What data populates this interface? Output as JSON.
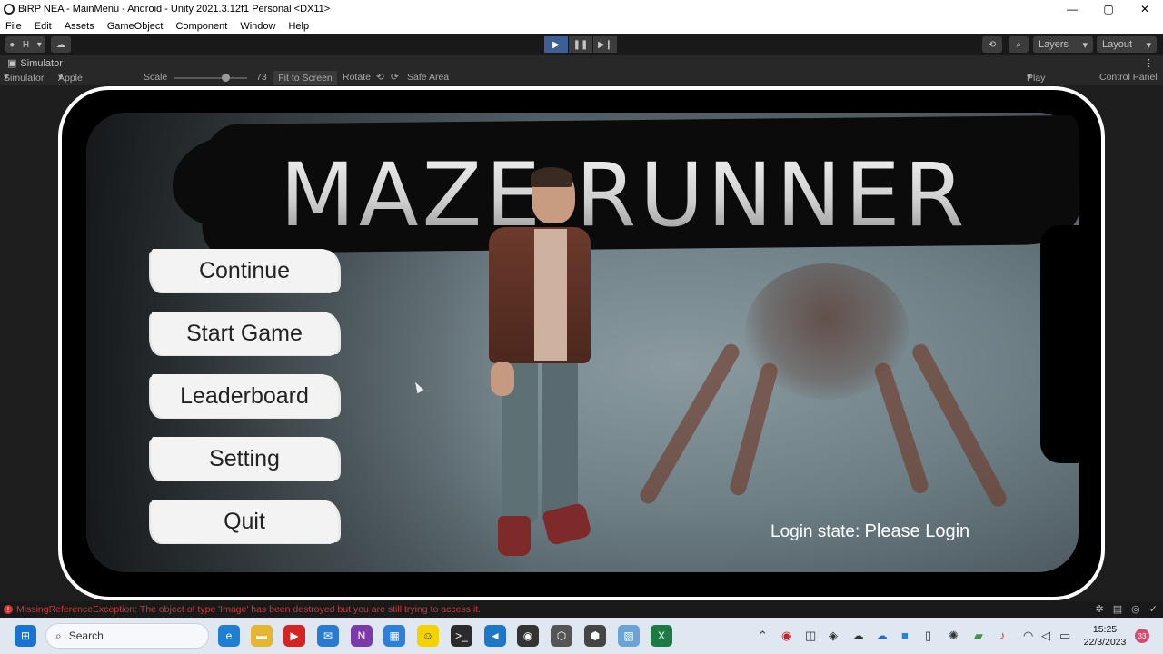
{
  "window": {
    "title": "BiRP NEA - MainMenu - Android - Unity 2021.3.12f1 Personal <DX11>",
    "controls": {
      "minimize": "—",
      "maximize": "▢",
      "close": "✕"
    }
  },
  "menubar": {
    "items": [
      "File",
      "Edit",
      "Assets",
      "GameObject",
      "Component",
      "Window",
      "Help"
    ]
  },
  "toolbar": {
    "account_label": "H",
    "play": "▶",
    "pause": "❚❚",
    "step": "▶❙",
    "layers_label": "Layers",
    "layout_label": "Layout",
    "history_icon": "⟲",
    "search_icon": "⌕"
  },
  "simulator": {
    "tab_title": "Simulator",
    "mode": "Simulator",
    "device": "Apple iPhone XR",
    "scale_label": "Scale",
    "scale_value": "73",
    "scale_fraction": 0.73,
    "fit_label": "Fit to Screen",
    "rotate_label": "Rotate",
    "safe_area_label": "Safe Area",
    "play_focused": "Play Focused",
    "control_panel": "Control Panel"
  },
  "game": {
    "title": "MAZE RUNNER",
    "menu": {
      "continue": "Continue",
      "start_game": "Start Game",
      "leaderboard": "Leaderboard",
      "setting": "Setting",
      "quit": "Quit"
    },
    "login_label": "Login state:",
    "login_value": "Please Login"
  },
  "status": {
    "error_message": "MissingReferenceException: The object of type 'Image' has been destroyed but you are still trying to access it."
  },
  "taskbar": {
    "search_placeholder": "Search",
    "time": "15:25",
    "date": "22/3/2023",
    "notification_count": "33"
  },
  "colors": {
    "editor_bg": "#191919",
    "play_active": "#3e5f96",
    "error_red": "#c93a3a",
    "taskbar_bg": "#dfe7f1"
  }
}
